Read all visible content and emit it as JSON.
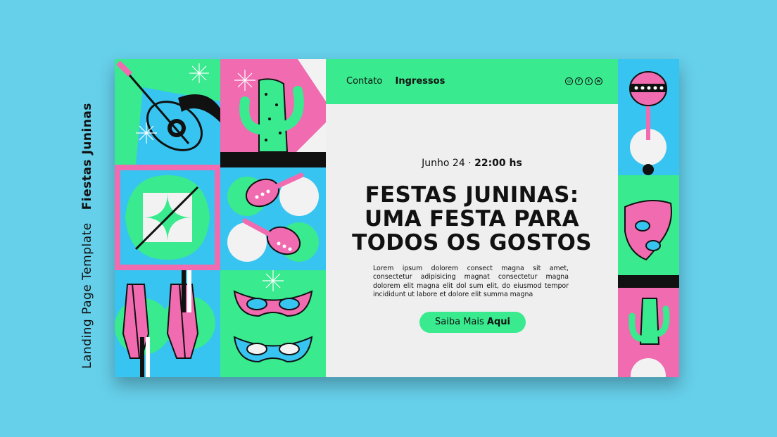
{
  "side_caption": {
    "template": "Landing Page Template",
    "title": "Fiestas Juninas"
  },
  "nav": {
    "contact": "Contato",
    "tickets": "Ingressos"
  },
  "socials": [
    "instagram-icon",
    "facebook-icon",
    "twitter-icon",
    "whatsapp-icon"
  ],
  "event": {
    "date": "Junho 24 ·",
    "time": "22:00 hs"
  },
  "headline": [
    "FESTAS JUNINAS:",
    "UMA FESTA PARA",
    "TODOS OS GOSTOS"
  ],
  "body": "Lorem ipsum dolorem consect magna sit amet, consectetur adipisicing magnat consectetur magna dolorem elit magna elit dol sum elit, do eiusmod tempor incididunt ut labore et dolore elit summa magna",
  "cta": {
    "prefix": "Saiba Mais",
    "emphasis": "Aqui"
  },
  "colors": {
    "background": "#66cfea",
    "green": "#39ea8e",
    "pink": "#f06bb0",
    "blue": "#38c4f0",
    "panel": "#efefef",
    "ink": "#111111"
  }
}
